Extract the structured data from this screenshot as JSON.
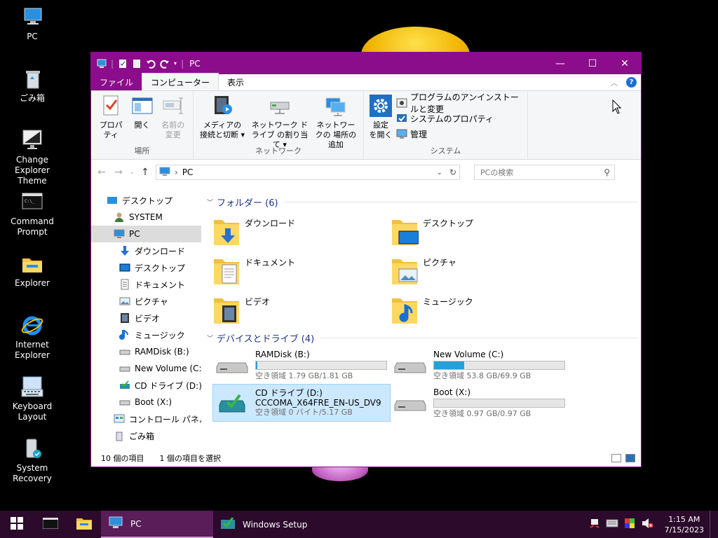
{
  "desktop": {
    "icons": [
      {
        "label": "PC",
        "icon": "pc-icon"
      },
      {
        "label": "ごみ箱",
        "icon": "recycle-bin-icon"
      },
      {
        "label": "Change Explorer Theme",
        "icon": "monitor-icon"
      },
      {
        "label": "Command Prompt",
        "icon": "terminal-icon"
      },
      {
        "label": "Explorer",
        "icon": "folder-icon"
      },
      {
        "label": "Internet Explorer",
        "icon": "ie-icon"
      },
      {
        "label": "Keyboard Layout",
        "icon": "keyboard-icon"
      },
      {
        "label": "System Recovery",
        "icon": "recovery-icon"
      }
    ]
  },
  "window": {
    "title": "PC",
    "controls": {
      "minimize": "—",
      "maximize": "☐",
      "close": "✕"
    },
    "tabs": [
      "ファイル",
      "コンピューター",
      "表示"
    ],
    "ribbon": {
      "location": {
        "label": "場所",
        "buttons": [
          {
            "label": "プロパティ",
            "icon": "properties-icon"
          },
          {
            "label": "開く",
            "icon": "open-icon"
          },
          {
            "label": "名前の 変更",
            "icon": "rename-icon"
          }
        ]
      },
      "network": {
        "label": "ネットワーク",
        "buttons": [
          {
            "label": "メディアの 接続と切断 ▾",
            "icon": "media-icon"
          },
          {
            "label": "ネットワーク ドライブ の割り当て ▾",
            "icon": "network-drive-icon"
          },
          {
            "label": "ネットワークの 場所の追加",
            "icon": "network-location-icon"
          }
        ]
      },
      "system": {
        "label": "システム",
        "big": {
          "label": "設定 を開く",
          "icon": "settings-icon"
        },
        "small": [
          {
            "label": "プログラムのアンインストールと変更",
            "icon": "uninstall-icon"
          },
          {
            "label": "システムのプロパティ",
            "icon": "system-properties-icon"
          },
          {
            "label": "管理",
            "icon": "manage-icon"
          }
        ]
      }
    },
    "address": {
      "path": "PC",
      "search_placeholder": "PCの検索"
    },
    "nav_pane": [
      {
        "label": "デスクトップ",
        "icon": "desktop-icon",
        "indent": 0
      },
      {
        "label": "SYSTEM",
        "icon": "user-icon",
        "indent": 1
      },
      {
        "label": "PC",
        "icon": "pc-icon",
        "indent": 1,
        "selected": true
      },
      {
        "label": "ダウンロード",
        "icon": "download-icon",
        "indent": 2
      },
      {
        "label": "デスクトップ",
        "icon": "desktop-icon",
        "indent": 2
      },
      {
        "label": "ドキュメント",
        "icon": "document-icon",
        "indent": 2
      },
      {
        "label": "ピクチャ",
        "icon": "pictures-icon",
        "indent": 2
      },
      {
        "label": "ビデオ",
        "icon": "video-icon",
        "indent": 2
      },
      {
        "label": "ミュージック",
        "icon": "music-icon",
        "indent": 2
      },
      {
        "label": "RAMDisk (B:)",
        "icon": "drive-icon",
        "indent": 2
      },
      {
        "label": "New Volume (C:)",
        "icon": "drive-icon",
        "indent": 2
      },
      {
        "label": "CD ドライブ (D:) CCC",
        "icon": "cd-drive-icon",
        "indent": 2
      },
      {
        "label": "Boot (X:)",
        "icon": "drive-icon",
        "indent": 2
      },
      {
        "label": "コントロール パネル",
        "icon": "control-panel-icon",
        "indent": 1
      },
      {
        "label": "ごみ箱",
        "icon": "recycle-bin-icon",
        "indent": 1
      }
    ],
    "folders_header": "フォルダー (6)",
    "folders": [
      {
        "name": "ダウンロード",
        "icon": "download-folder-icon"
      },
      {
        "name": "デスクトップ",
        "icon": "desktop-folder-icon"
      },
      {
        "name": "ドキュメント",
        "icon": "documents-folder-icon"
      },
      {
        "name": "ピクチャ",
        "icon": "pictures-folder-icon"
      },
      {
        "name": "ビデオ",
        "icon": "videos-folder-icon"
      },
      {
        "name": "ミュージック",
        "icon": "music-folder-icon"
      }
    ],
    "drives_header": "デバイスとドライブ (4)",
    "drives": [
      {
        "name": "RAMDisk (B:)",
        "sub": "空き領域 1.79 GB/1.81 GB",
        "used_fraction": 0.011,
        "icon": "drive-icon"
      },
      {
        "name": "New Volume (C:)",
        "sub": "空き領域 53.8 GB/69.9 GB",
        "used_fraction": 0.23,
        "icon": "drive-icon"
      },
      {
        "name": "CD ドライブ (D:)",
        "name2": "CCCOMA_X64FRE_EN-US_DV9",
        "sub": "空き領域 0 バイト/5.17 GB",
        "icon": "cd-drive-icon",
        "selected": true
      },
      {
        "name": "Boot (X:)",
        "sub": "空き領域 0.97 GB/0.97 GB",
        "used_fraction": 0.0,
        "icon": "drive-icon"
      }
    ],
    "status": {
      "items": "10 個の項目",
      "selected": "1 個の項目を選択"
    }
  },
  "taskbar": {
    "apps": [
      {
        "label": "",
        "icon": "terminal-icon"
      },
      {
        "label": "",
        "icon": "explorer-icon"
      },
      {
        "label": "PC",
        "icon": "pc-icon",
        "active": true
      },
      {
        "label": "Windows Setup",
        "icon": "setup-icon"
      }
    ],
    "time": "1:15 AM",
    "date": "7/15/2023"
  }
}
